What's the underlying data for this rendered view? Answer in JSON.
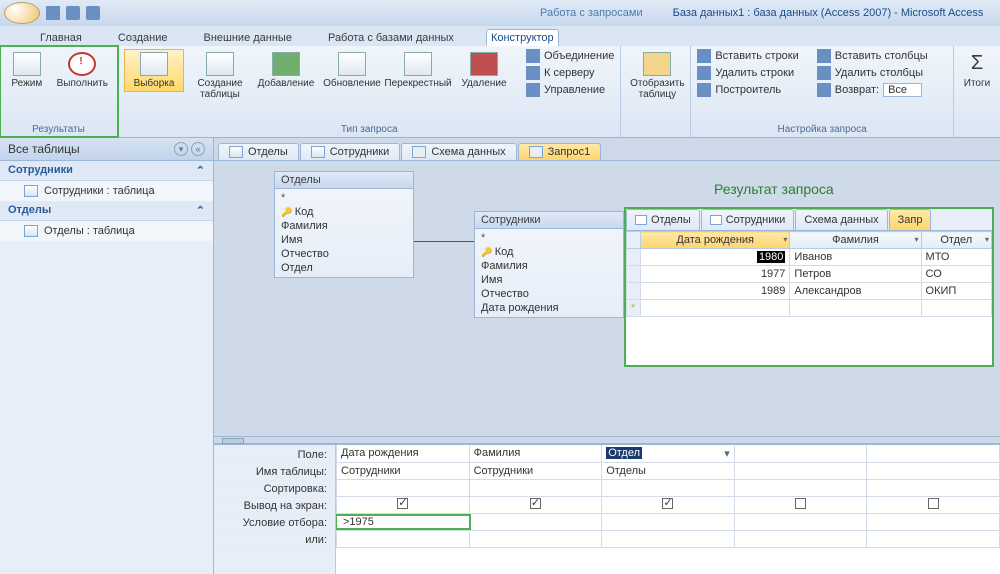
{
  "title": {
    "context_tab": "Работа с запросами",
    "filename": "База данных1 : база данных (Access 2007) - Microsoft Access"
  },
  "ribbon_tabs": [
    "Главная",
    "Создание",
    "Внешние данные",
    "Работа с базами данных",
    "Конструктор"
  ],
  "active_ribbon_tab": "Конструктор",
  "ribbon": {
    "results_group": "Результаты",
    "mode": "Режим",
    "execute": "Выполнить",
    "querytype_group": "Тип запроса",
    "select": "Выборка",
    "maketable": "Создание таблицы",
    "append": "Добавление",
    "update": "Обновление",
    "crosstab": "Перекрестный",
    "delete": "Удаление",
    "union": "Объединение",
    "toserver": "К серверу",
    "managed": "Управление",
    "showtable": "Отобразить таблицу",
    "setup_group": "Настройка запроса",
    "ins_rows": "Вставить строки",
    "del_rows": "Удалить строки",
    "builder": "Построитель",
    "ins_cols": "Вставить столбцы",
    "del_cols": "Удалить столбцы",
    "return": "Возврат:",
    "return_val": "Все",
    "totals": "Итоги"
  },
  "nav": {
    "header": "Все таблицы",
    "group1": "Сотрудники",
    "item1": "Сотрудники : таблица",
    "group2": "Отделы",
    "item2": "Отделы : таблица"
  },
  "doc_tabs": [
    "Отделы",
    "Сотрудники",
    "Схема данных",
    "Запрос1"
  ],
  "relation": {
    "t1": {
      "title": "Отделы",
      "fields": [
        "*",
        "Код",
        "Фамилия",
        "Имя",
        "Отчество",
        "Отдел"
      ],
      "key_index": 1
    },
    "t2": {
      "title": "Сотрудники",
      "fields": [
        "*",
        "Код",
        "Фамилия",
        "Имя",
        "Отчество",
        "Дата рождения"
      ],
      "key_index": 1
    }
  },
  "result": {
    "caption": "Результат запроса",
    "tabs": [
      "Отделы",
      "Сотрудники",
      "Схема данных",
      "Запр"
    ],
    "columns": [
      "Дата рождения",
      "Фамилия",
      "Отдел"
    ],
    "rows": [
      {
        "year": "1980",
        "fam": "Иванов",
        "dep": "МТО",
        "hl": true
      },
      {
        "year": "1977",
        "fam": "Петров",
        "dep": "СО"
      },
      {
        "year": "1989",
        "fam": "Александров",
        "dep": "ОКИП"
      }
    ]
  },
  "qbe": {
    "labels": [
      "Поле:",
      "Имя таблицы:",
      "Сортировка:",
      "Вывод на экран:",
      "Условие отбора:",
      "или:"
    ],
    "cols": [
      {
        "field": "Дата рождения",
        "table": "Сотрудники",
        "show": true,
        "criteria": ">1975"
      },
      {
        "field": "Фамилия",
        "table": "Сотрудники",
        "show": true,
        "criteria": ""
      },
      {
        "field": "Отдел",
        "table": "Отделы",
        "show": true,
        "criteria": "",
        "selected": true
      },
      {
        "field": "",
        "table": "",
        "show": false,
        "criteria": ""
      },
      {
        "field": "",
        "table": "",
        "show": false,
        "criteria": ""
      }
    ]
  }
}
